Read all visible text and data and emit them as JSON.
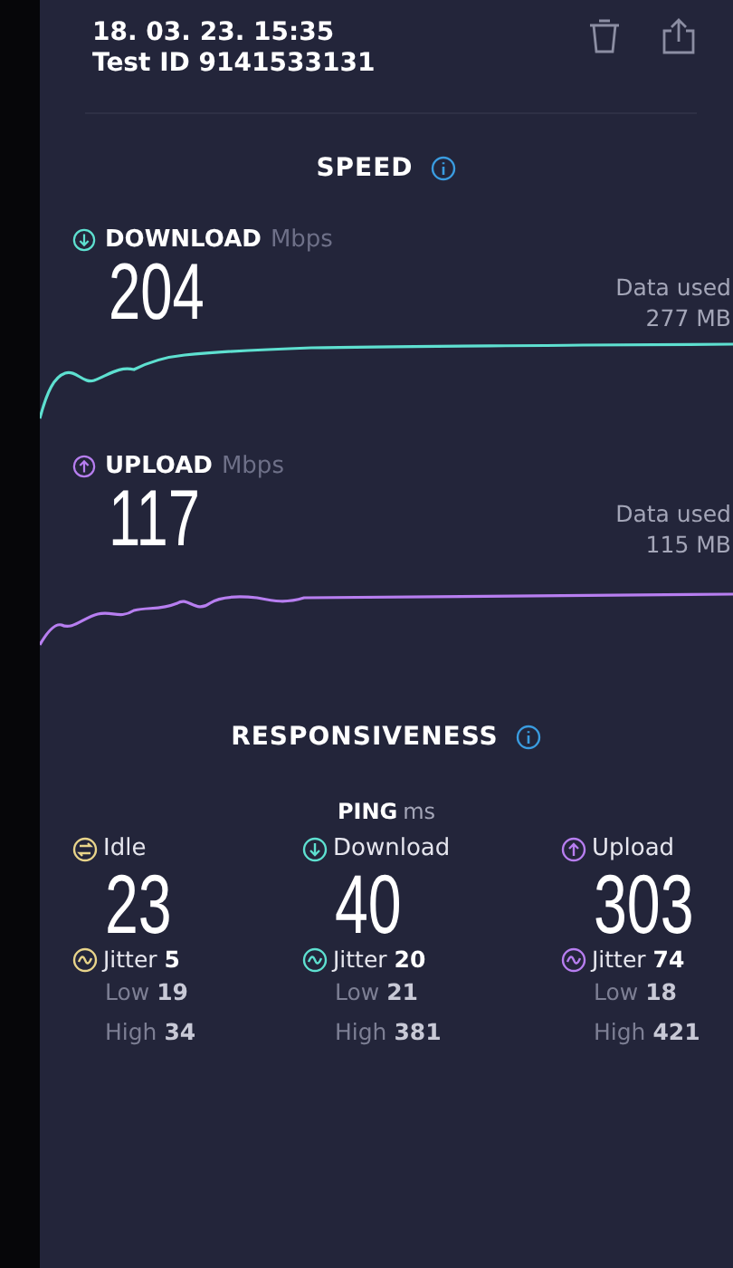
{
  "header": {
    "date": "18. 03. 23. 15:35",
    "test_id": "Test ID 9141533131"
  },
  "speed": {
    "title": "SPEED",
    "sections": [
      {
        "kind": "download",
        "label": "DOWNLOAD",
        "unit": "Mbps",
        "value": "204",
        "data_label": "Data used",
        "data_value": "277 MB",
        "color": "#5ee0d0"
      },
      {
        "kind": "upload",
        "label": "UPLOAD",
        "unit": "Mbps",
        "value": "117",
        "data_label": "Data used",
        "data_value": "115 MB",
        "color": "#b77ef0"
      }
    ]
  },
  "responsiveness": {
    "title": "RESPONSIVENESS",
    "ping_label": "PING",
    "ping_unit": "ms",
    "columns": [
      {
        "kind": "idle",
        "label": "Idle",
        "value": "23",
        "jitter": "Jitter **5**",
        "low": "Low **19**",
        "high": "High **34**",
        "color": "#e8d48a"
      },
      {
        "kind": "download",
        "label": "Download",
        "value": "40",
        "jitter": "Jitter **20**",
        "low": "Low **21**",
        "high": "High **381**",
        "color": "#5ee0d0"
      },
      {
        "kind": "upload",
        "label": "Upload",
        "value": "303",
        "jitter": "Jitter **74**",
        "low": "Low **18**",
        "high": "High **421**",
        "color": "#b77ef0"
      }
    ]
  }
}
